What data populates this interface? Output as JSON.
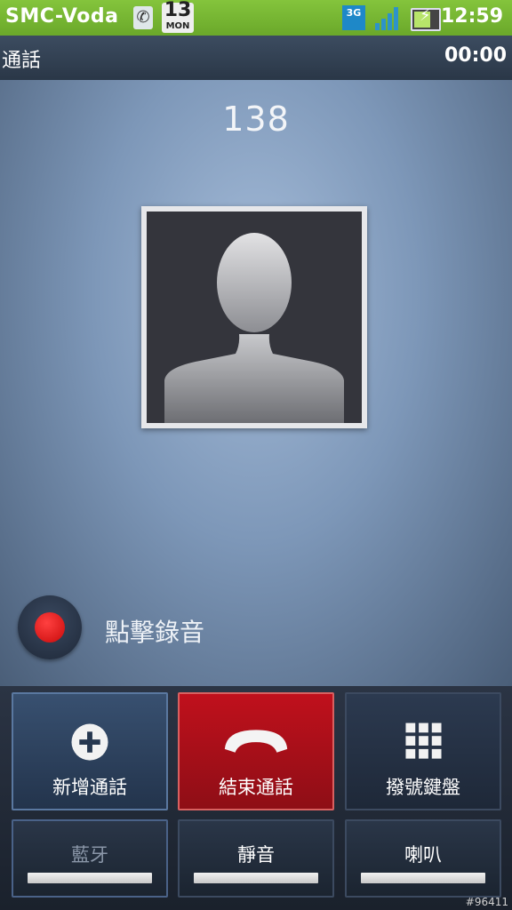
{
  "status_bar": {
    "carrier": "SMC-Voda",
    "calendar_day": "13",
    "calendar_weekday": "MON",
    "network": "3G",
    "time": "12:59",
    "icons": [
      "phone-call-icon",
      "calendar-icon",
      "network-3g-icon",
      "signal-icon",
      "battery-charging-icon"
    ]
  },
  "title_bar": {
    "title": "通話",
    "timer": "00:00"
  },
  "call": {
    "number": "138"
  },
  "record": {
    "label": "點擊錄音"
  },
  "buttons": {
    "add_call": "新增通話",
    "end_call": "結束通話",
    "dialpad": "撥號鍵盤",
    "bluetooth": "藍牙",
    "mute": "靜音",
    "speaker": "喇叭"
  },
  "watermark": "#96411",
  "colors": {
    "status_bar": "#7cbd36",
    "end_call": "#b0101a",
    "record_dot": "#e01515"
  }
}
